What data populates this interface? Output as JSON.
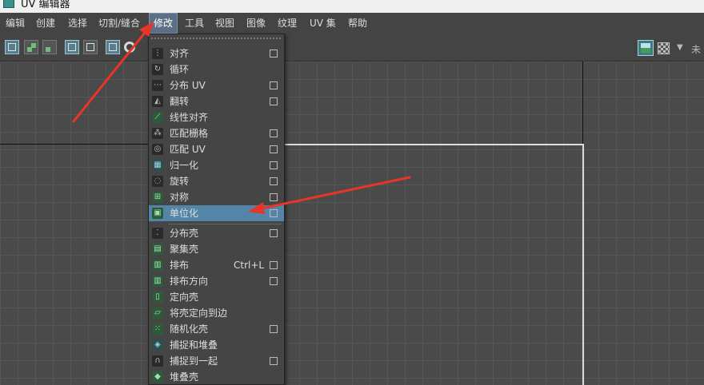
{
  "window": {
    "title": "UV 编辑器"
  },
  "menubar": {
    "items": [
      "编辑",
      "创建",
      "选择",
      "切割/缝合",
      "修改",
      "工具",
      "视图",
      "图像",
      "纹理",
      "UV 集",
      "帮助"
    ],
    "active_index": 4
  },
  "toolbar": {
    "right_label": "未"
  },
  "dropdown": {
    "items": [
      {
        "label": "对齐",
        "shortcut": "",
        "has_option": true,
        "icon": "align-icon"
      },
      {
        "label": "循环",
        "shortcut": "",
        "has_option": false,
        "icon": "cycle-icon"
      },
      {
        "label": "分布 UV",
        "shortcut": "",
        "has_option": true,
        "icon": "distribute-icon"
      },
      {
        "label": "翻转",
        "shortcut": "",
        "has_option": true,
        "icon": "flip-icon"
      },
      {
        "label": "线性对齐",
        "shortcut": "",
        "has_option": false,
        "icon": "linear-align-icon"
      },
      {
        "label": "匹配栅格",
        "shortcut": "",
        "has_option": true,
        "icon": "match-grid-icon"
      },
      {
        "label": "匹配 UV",
        "shortcut": "",
        "has_option": true,
        "icon": "match-uv-icon"
      },
      {
        "label": "归一化",
        "shortcut": "",
        "has_option": true,
        "icon": "normalize-icon"
      },
      {
        "label": "旋转",
        "shortcut": "",
        "has_option": true,
        "icon": "rotate-icon"
      },
      {
        "label": "对称",
        "shortcut": "",
        "has_option": true,
        "icon": "symmetry-icon"
      },
      {
        "label": "单位化",
        "shortcut": "",
        "has_option": true,
        "icon": "unitize-icon",
        "highlighted": true
      },
      {
        "label": "分布壳",
        "shortcut": "",
        "has_option": true,
        "icon": "distribute-shells-icon"
      },
      {
        "label": "聚集壳",
        "shortcut": "",
        "has_option": false,
        "icon": "gather-shells-icon"
      },
      {
        "label": "排布",
        "shortcut": "Ctrl+L",
        "has_option": true,
        "icon": "layout-icon"
      },
      {
        "label": "排布方向",
        "shortcut": "",
        "has_option": true,
        "icon": "layout-direction-icon"
      },
      {
        "label": "定向壳",
        "shortcut": "",
        "has_option": false,
        "icon": "orient-shells-icon"
      },
      {
        "label": "将壳定向到边",
        "shortcut": "",
        "has_option": false,
        "icon": "orient-to-edges-icon"
      },
      {
        "label": "随机化壳",
        "shortcut": "",
        "has_option": true,
        "icon": "randomize-shells-icon"
      },
      {
        "label": "捕捉和堆叠",
        "shortcut": "",
        "has_option": false,
        "icon": "snap-stack-icon"
      },
      {
        "label": "捕捉到一起",
        "shortcut": "",
        "has_option": true,
        "icon": "snap-together-icon"
      },
      {
        "label": "堆叠壳",
        "shortcut": "",
        "has_option": false,
        "icon": "stack-shells-icon"
      }
    ]
  },
  "colors": {
    "highlight": "#5285a6",
    "arrow": "#e8352a",
    "menu_bg": "#454545"
  }
}
